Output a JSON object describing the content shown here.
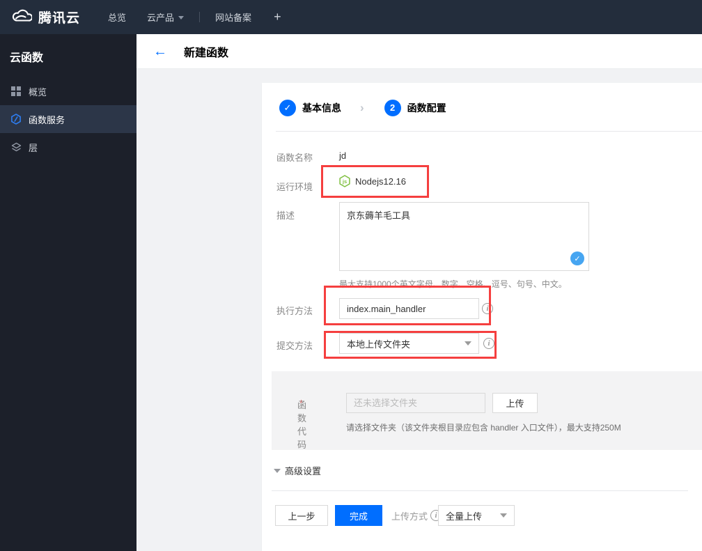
{
  "topbar": {
    "brand": "腾讯云",
    "overview": "总览",
    "products": "云产品",
    "beian": "网站备案",
    "plus": "+"
  },
  "sidebar": {
    "title": "云函数",
    "items": [
      {
        "label": "概览",
        "icon": "grid-icon"
      },
      {
        "label": "函数服务",
        "icon": "function-hexagon-icon",
        "active": true
      },
      {
        "label": "层",
        "icon": "layers-icon"
      }
    ]
  },
  "header": {
    "back": "←",
    "title": "新建函数"
  },
  "steps": {
    "step1_mark": "✓",
    "step1_label": "基本信息",
    "separator": "›",
    "step2_num": "2",
    "step2_label": "函数配置"
  },
  "form": {
    "name_label": "函数名称",
    "name_value": "jd",
    "runtime_label": "运行环境",
    "runtime_value": "Nodejs12.16",
    "desc_label": "描述",
    "desc_value": "京东薅羊毛工具",
    "desc_check": "✓",
    "desc_help": "最大支持1000个英文字母、数字、空格、逗号、句号、中文。",
    "handler_label": "执行方法",
    "handler_value": "index.main_handler",
    "submit_label": "提交方法",
    "submit_value": "本地上传文件夹",
    "info_glyph": "i",
    "code_label": "函数代码",
    "required_mark": "*",
    "code_placeholder": "还未选择文件夹",
    "upload_button": "上传",
    "code_help": "请选择文件夹（该文件夹根目录应包含 handler 入口文件），最大支持250M",
    "advanced_label": "高级设置",
    "prev_button": "上一步",
    "finish_button": "完成",
    "upload_mode_label": "上传方式",
    "upload_mode_value": "全量上传"
  },
  "colors": {
    "accent_blue": "#006eff",
    "highlight_red": "#f53f3f",
    "node_green": "#7fbf3f",
    "check_blue": "#46a5f1",
    "topbar_bg": "#232d3c",
    "sidebar_bg": "#1c202a"
  }
}
